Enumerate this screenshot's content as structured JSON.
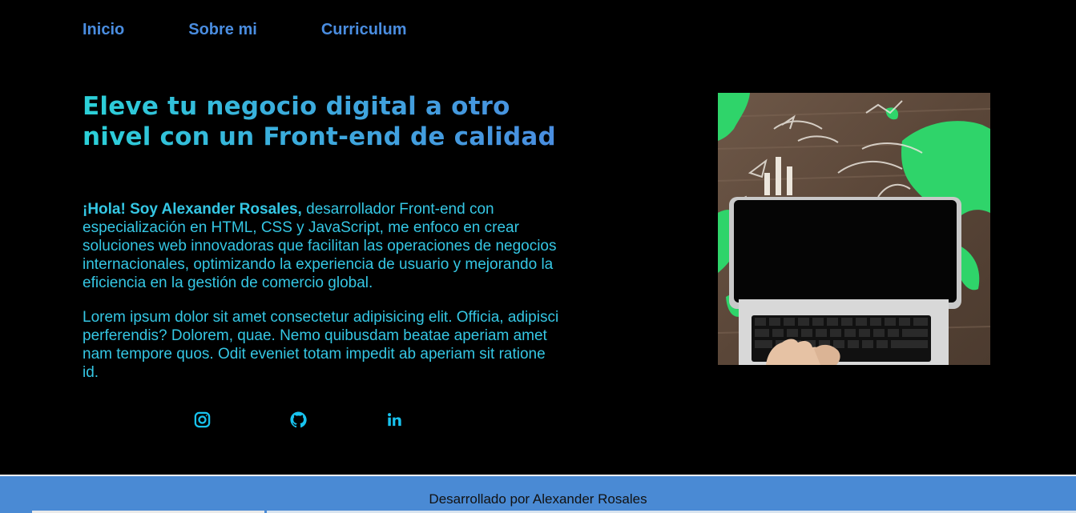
{
  "nav": {
    "items": [
      {
        "label": "Inicio"
      },
      {
        "label": "Sobre mi"
      },
      {
        "label": "Curriculum"
      }
    ]
  },
  "hero": {
    "title": "Eleve tu negocio digital a otro nivel con un Front-end de calidad",
    "intro_bold": "¡Hola! Soy Alexander Rosales,",
    "intro_rest": " desarrollador Front-end con especialización en HTML, CSS y JavaScript, me enfoco en crear soluciones web innovadoras que facilitan las operaciones de negocios internacionales, optimizando la experiencia de usuario y mejorando la eficiencia en la gestión de comercio global.",
    "lorem": "Lorem ipsum dolor sit amet consectetur adipisicing elit. Officia, adipisci perferendis? Dolorem, quae. Nemo quibusdam beatae aperiam amet nam tempore quos. Odit eveniet totam impedit ab aperiam sit ratione id."
  },
  "socials": [
    {
      "icon": "instagram-icon"
    },
    {
      "icon": "github-icon"
    },
    {
      "icon": "linkedin-icon"
    }
  ],
  "footer": {
    "text": "Desarrollado por Alexander Rosales"
  },
  "colors": {
    "accent": "#4a8de0",
    "text_cyan": "#35c7e4",
    "footer_bg": "#4a8ad4"
  }
}
